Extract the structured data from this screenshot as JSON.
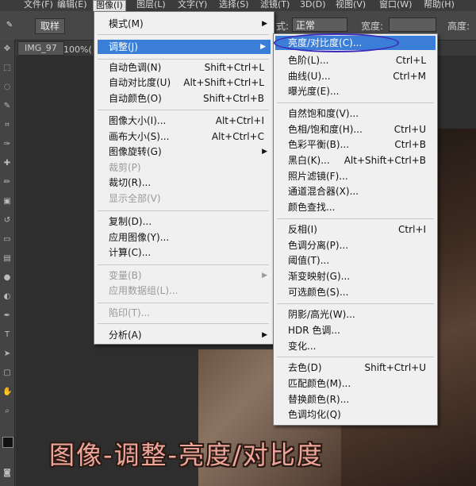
{
  "menubar": {
    "items": [
      {
        "label": "文件(F)"
      },
      {
        "label": "编辑(E)"
      },
      {
        "label": "图像(I)"
      },
      {
        "label": "图层(L)"
      },
      {
        "label": "文字(Y)"
      },
      {
        "label": "选择(S)"
      },
      {
        "label": "滤镜(T)"
      },
      {
        "label": "3D(D)"
      },
      {
        "label": "视图(V)"
      },
      {
        "label": "窗口(W)"
      },
      {
        "label": "帮助(H)"
      }
    ]
  },
  "options_bar": {
    "cancel_label": "取样",
    "mode_label_suffix": "式:",
    "mode_value": "正常",
    "width_label": "宽度:",
    "height_label": "高度:"
  },
  "document": {
    "tab_label": "IMG_97",
    "zoom_label": "100%("
  },
  "image_menu": {
    "items": [
      {
        "label": "模式(M)",
        "shortcut": "",
        "submenu": true,
        "disabled": false
      },
      {
        "label": "调整(J)",
        "shortcut": "",
        "submenu": true,
        "disabled": false,
        "highlighted": true
      },
      {
        "label": "自动色调(N)",
        "shortcut": "Shift+Ctrl+L"
      },
      {
        "label": "自动对比度(U)",
        "shortcut": "Alt+Shift+Ctrl+L"
      },
      {
        "label": "自动颜色(O)",
        "shortcut": "Shift+Ctrl+B"
      },
      {
        "label": "图像大小(I)...",
        "shortcut": "Alt+Ctrl+I"
      },
      {
        "label": "画布大小(S)...",
        "shortcut": "Alt+Ctrl+C"
      },
      {
        "label": "图像旋转(G)",
        "shortcut": "",
        "submenu": true
      },
      {
        "label": "裁剪(P)",
        "shortcut": "",
        "disabled": true
      },
      {
        "label": "裁切(R)...",
        "shortcut": ""
      },
      {
        "label": "显示全部(V)",
        "shortcut": "",
        "disabled": true
      },
      {
        "label": "复制(D)...",
        "shortcut": ""
      },
      {
        "label": "应用图像(Y)...",
        "shortcut": ""
      },
      {
        "label": "计算(C)...",
        "shortcut": ""
      },
      {
        "label": "变量(B)",
        "shortcut": "",
        "submenu": true,
        "disabled": true
      },
      {
        "label": "应用数据组(L)...",
        "shortcut": "",
        "disabled": true
      },
      {
        "label": "陷印(T)...",
        "shortcut": "",
        "disabled": true
      },
      {
        "label": "分析(A)",
        "shortcut": "",
        "submenu": true
      }
    ]
  },
  "adjust_menu": {
    "items": [
      {
        "label": "亮度/对比度(C)...",
        "shortcut": "",
        "highlighted": true
      },
      {
        "label": "色阶(L)...",
        "shortcut": "Ctrl+L"
      },
      {
        "label": "曲线(U)...",
        "shortcut": "Ctrl+M"
      },
      {
        "label": "曝光度(E)...",
        "shortcut": ""
      },
      {
        "label": "自然饱和度(V)...",
        "shortcut": ""
      },
      {
        "label": "色相/饱和度(H)...",
        "shortcut": "Ctrl+U"
      },
      {
        "label": "色彩平衡(B)...",
        "shortcut": "Ctrl+B"
      },
      {
        "label": "黑白(K)...",
        "shortcut": "Alt+Shift+Ctrl+B"
      },
      {
        "label": "照片滤镜(F)...",
        "shortcut": ""
      },
      {
        "label": "通道混合器(X)...",
        "shortcut": ""
      },
      {
        "label": "颜色查找...",
        "shortcut": ""
      },
      {
        "label": "反相(I)",
        "shortcut": "Ctrl+I"
      },
      {
        "label": "色调分离(P)...",
        "shortcut": ""
      },
      {
        "label": "阈值(T)...",
        "shortcut": ""
      },
      {
        "label": "渐变映射(G)...",
        "shortcut": ""
      },
      {
        "label": "可选颜色(S)...",
        "shortcut": ""
      },
      {
        "label": "阴影/高光(W)...",
        "shortcut": ""
      },
      {
        "label": "HDR 色调...",
        "shortcut": ""
      },
      {
        "label": "变化...",
        "shortcut": ""
      },
      {
        "label": "去色(D)",
        "shortcut": "Shift+Ctrl+U"
      },
      {
        "label": "匹配颜色(M)...",
        "shortcut": ""
      },
      {
        "label": "替换颜色(R)...",
        "shortcut": ""
      },
      {
        "label": "色调均化(Q)",
        "shortcut": ""
      }
    ]
  },
  "caption": {
    "text": "图像-调整-亮度/对比度"
  },
  "colors": {
    "highlight": "#3a7ed8",
    "annotation": "#3d2bb8",
    "caption": "#f0a59a"
  }
}
